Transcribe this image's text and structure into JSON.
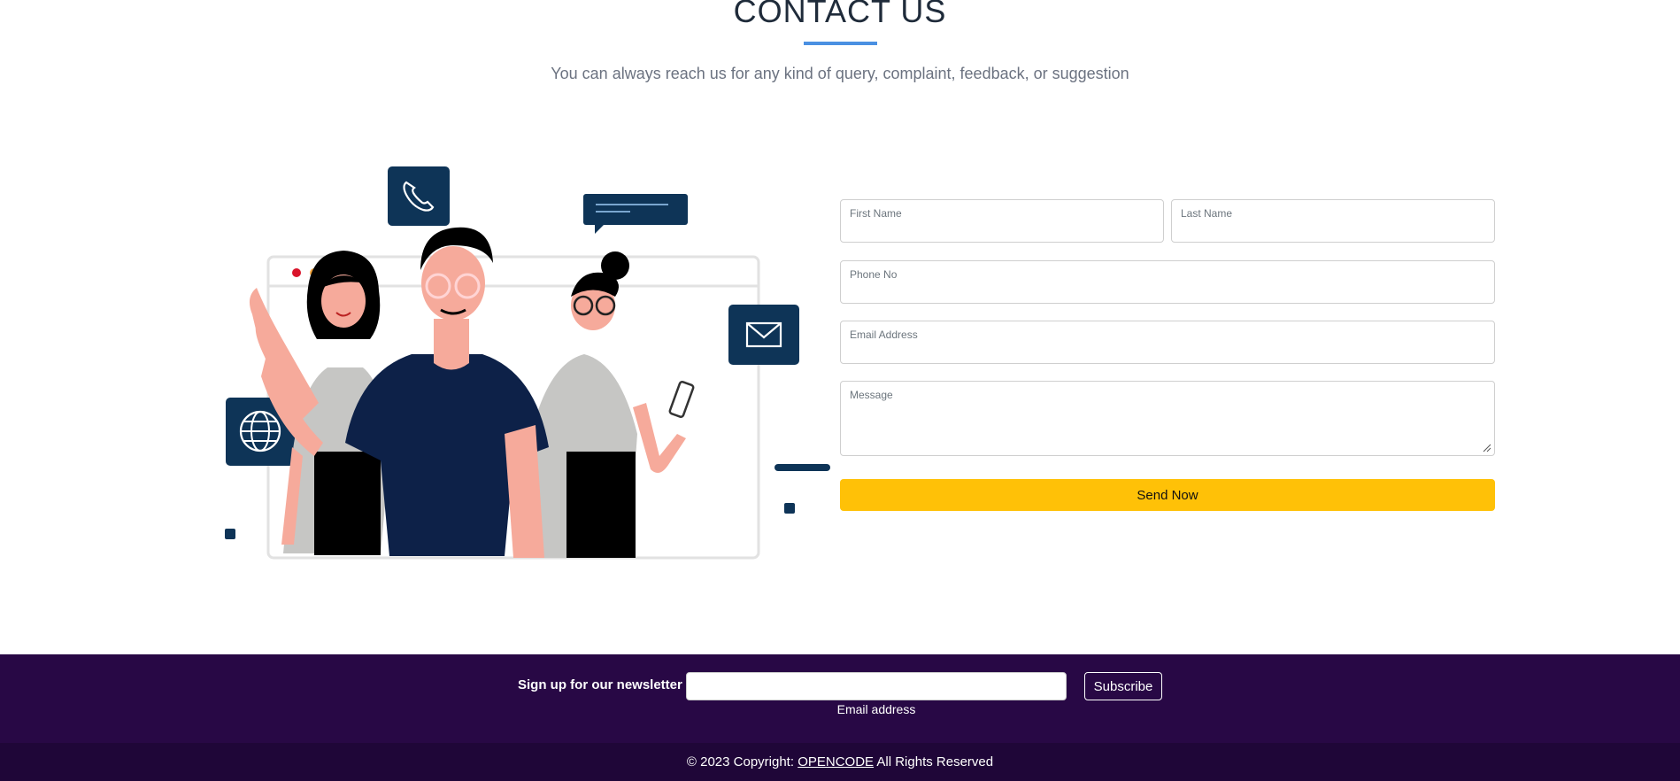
{
  "header": {
    "title": "CONTACT US",
    "subtitle": "You can always reach us for any kind of query, complaint, feedback, or suggestion"
  },
  "form": {
    "first_name_label": "First Name",
    "last_name_label": "Last Name",
    "phone_label": "Phone No",
    "email_label": "Email Address",
    "message_label": "Message",
    "first_name_value": "",
    "last_name_value": "",
    "phone_value": "",
    "email_value": "",
    "message_value": "",
    "submit_label": "Send Now"
  },
  "newsletter": {
    "label": "Sign up for our newsletter",
    "email_value": "",
    "email_help": "Email address",
    "subscribe_label": "Subscribe"
  },
  "footer": {
    "prefix": "© 2023 Copyright:",
    "brand_link": "OPENCODE",
    "suffix": "All Rights Reserved"
  },
  "icons": [
    "phone-icon",
    "chat-bubble-icon",
    "envelope-icon",
    "globe-icon"
  ],
  "colors": {
    "accent_underline": "#4a90e2",
    "submit_button": "#ffc107",
    "newsletter_bg": "#280845",
    "footer_bg": "#1f0638",
    "icon_tile": "#0e3457"
  }
}
